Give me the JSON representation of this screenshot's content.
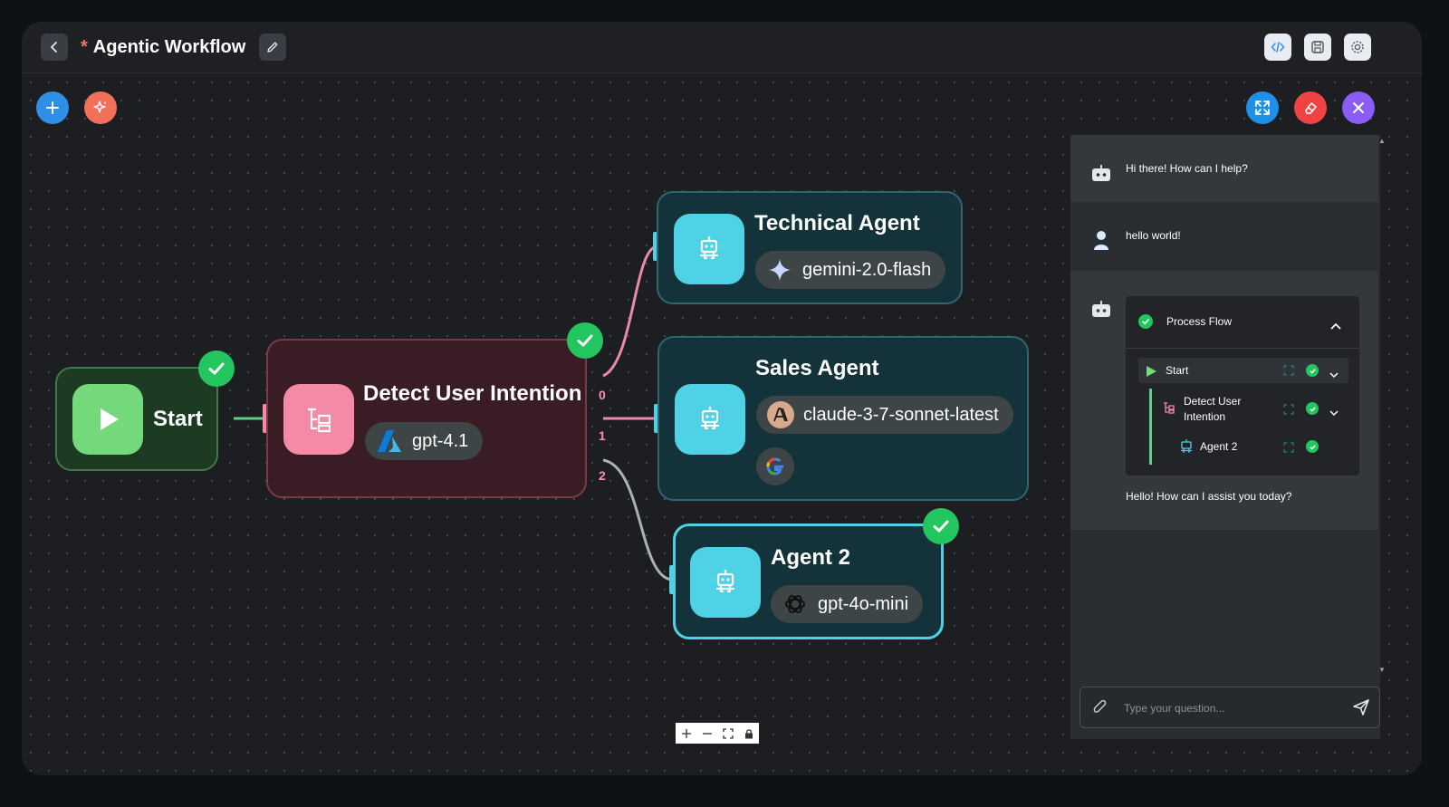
{
  "header": {
    "unsaved_marker": "*",
    "title": "Agentic Workflow"
  },
  "nodes": {
    "start": {
      "title": "Start"
    },
    "detect": {
      "title": "Detect User Intention",
      "model": "gpt-4.1",
      "branches": [
        "0",
        "1",
        "2"
      ]
    },
    "technical": {
      "title": "Technical Agent",
      "model": "gemini-2.0-flash"
    },
    "sales": {
      "title": "Sales Agent",
      "model": "claude-3-7-sonnet-latest"
    },
    "agent2": {
      "title": "Agent 2",
      "model": "gpt-4o-mini"
    }
  },
  "chat": {
    "messages": [
      {
        "role": "bot",
        "text": "Hi there! How can I help?"
      },
      {
        "role": "user",
        "text": "hello world!"
      },
      {
        "role": "bot",
        "text": "Hello! How can I assist you today?"
      }
    ],
    "process_flow": {
      "title": "Process Flow",
      "steps": [
        {
          "label": "Start"
        },
        {
          "label": "Detect User Intention"
        },
        {
          "label": "Agent 2"
        }
      ]
    },
    "input_placeholder": "Type your question..."
  },
  "colors": {
    "accent_blue": "#2f8fe6",
    "accent_orange": "#f2705a",
    "success": "#22c55e",
    "node_teal": "#4fd1e6",
    "node_pink": "#f48aa6",
    "node_green": "#74d97a"
  }
}
